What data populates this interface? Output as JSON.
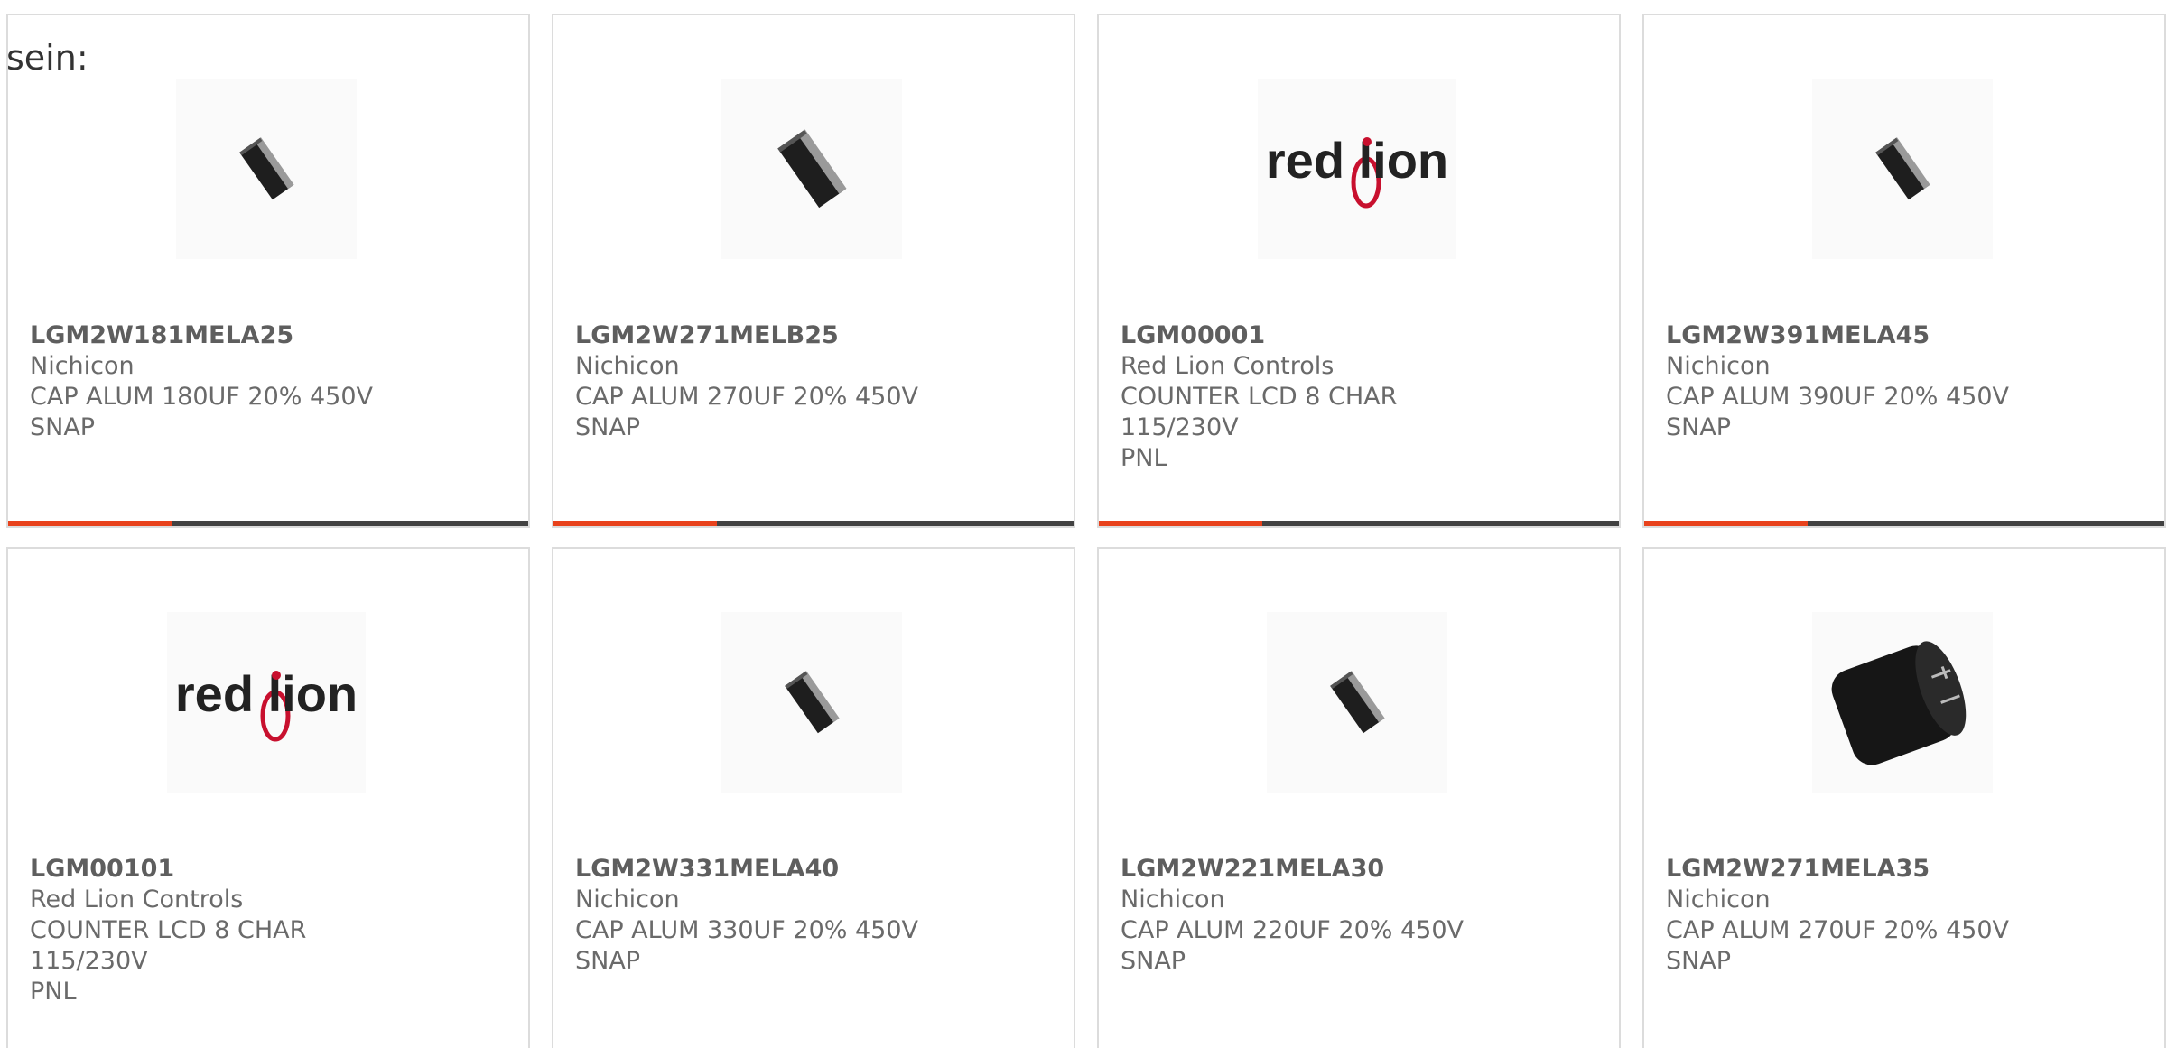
{
  "intro_text": "sein:",
  "colors": {
    "accent": "#e8421c",
    "bar_track": "#424242",
    "card_border": "#dcdcdc"
  },
  "products": [
    {
      "part_number": "LGM2W181MELA25",
      "manufacturer": "Nichicon",
      "description": "CAP ALUM 180UF 20% 450V SNAP",
      "description_lines": [
        "CAP ALUM 180UF 20% 450V",
        "SNAP"
      ],
      "image": "capacitor-small",
      "progress": 0.316
    },
    {
      "part_number": "LGM2W271MELB25",
      "manufacturer": "Nichicon",
      "description": "CAP ALUM 270UF 20% 450V SNAP",
      "description_lines": [
        "CAP ALUM 270UF 20% 450V",
        "SNAP"
      ],
      "image": "capacitor-medium",
      "progress": 0.316
    },
    {
      "part_number": "LGM00001",
      "manufacturer": "Red Lion Controls",
      "description": "COUNTER LCD 8 CHAR 115/230V PNL",
      "description_lines": [
        "COUNTER LCD 8 CHAR 115/230V",
        "PNL"
      ],
      "image": "red-lion-logo",
      "logo_text": "red lion",
      "progress": 0.316
    },
    {
      "part_number": "LGM2W391MELA45",
      "manufacturer": "Nichicon",
      "description": "CAP ALUM 390UF 20% 450V SNAP",
      "description_lines": [
        "CAP ALUM 390UF 20% 450V",
        "SNAP"
      ],
      "image": "capacitor-small",
      "progress": 0.316
    },
    {
      "part_number": "LGM00101",
      "manufacturer": "Red Lion Controls",
      "description": "COUNTER LCD 8 CHAR 115/230V PNL",
      "description_lines": [
        "COUNTER LCD 8 CHAR 115/230V",
        "PNL"
      ],
      "image": "red-lion-logo",
      "logo_text": "red lion"
    },
    {
      "part_number": "LGM2W331MELA40",
      "manufacturer": "Nichicon",
      "description": "CAP ALUM 330UF 20% 450V SNAP",
      "description_lines": [
        "CAP ALUM 330UF 20% 450V",
        "SNAP"
      ],
      "image": "capacitor-small"
    },
    {
      "part_number": "LGM2W221MELA30",
      "manufacturer": "Nichicon",
      "description": "CAP ALUM 220UF 20% 450V SNAP",
      "description_lines": [
        "CAP ALUM 220UF 20% 450V",
        "SNAP"
      ],
      "image": "capacitor-small"
    },
    {
      "part_number": "LGM2W271MELA35",
      "manufacturer": "Nichicon",
      "description": "CAP ALUM 270UF 20% 450V SNAP",
      "description_lines": [
        "CAP ALUM 270UF 20% 450V",
        "SNAP"
      ],
      "image": "capacitor-large"
    }
  ]
}
